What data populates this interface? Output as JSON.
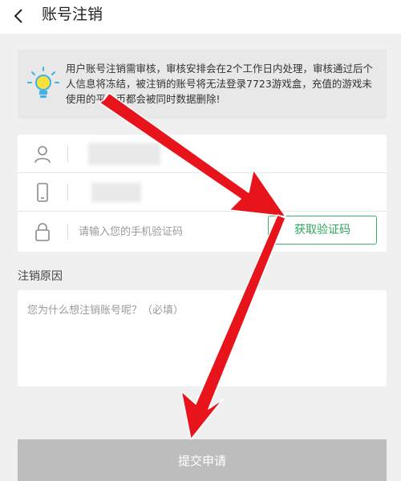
{
  "header": {
    "title": "账号注销",
    "back_icon": "chevron-left-icon"
  },
  "notice": {
    "icon": "lightbulb-icon",
    "text": "用户账号注销需审核，审核安排会在2个工作日内处理，审核通过后个人信息将冻结，被注销的账号将无法登录7723游戏盒，充值的游戏未使用的平台币都会被同时数据删除!"
  },
  "form": {
    "rows": [
      {
        "icon": "user-icon",
        "value": ""
      },
      {
        "icon": "phone-icon",
        "value": ""
      },
      {
        "icon": "lock-icon",
        "placeholder": "请输入您的手机验证码"
      }
    ],
    "get_code_label": "获取验证码"
  },
  "reason": {
    "label": "注销原因",
    "placeholder": "您为什么想注销账号呢？（必填）"
  },
  "submit": {
    "label": "提交申请"
  },
  "annotation": {
    "arrow_color": "#e8141b",
    "accent_green": "#2fa85c",
    "submit_bg": "#bdbdbd"
  }
}
